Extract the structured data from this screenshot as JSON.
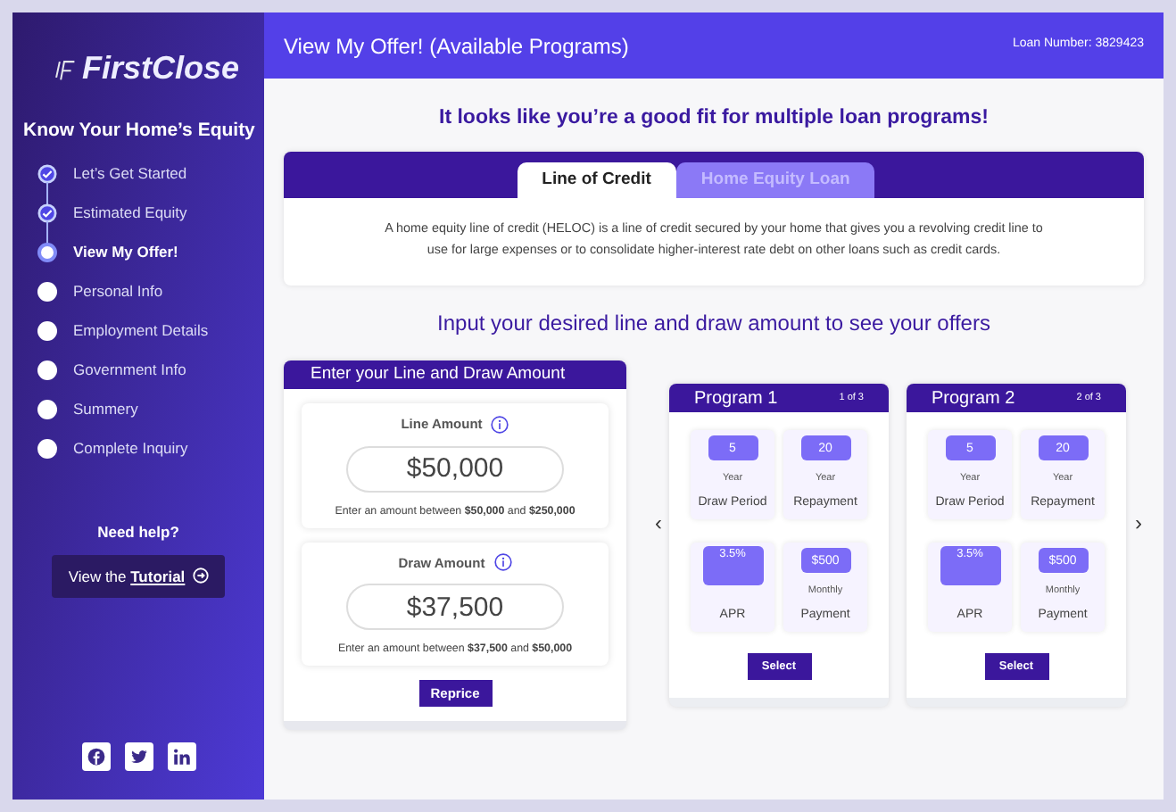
{
  "brand": {
    "name": "FirstClose"
  },
  "sidebar": {
    "title": "Know Your Home’s Equity",
    "steps": [
      {
        "label": "Let’s Get Started",
        "completed": true,
        "selected": false
      },
      {
        "label": "Estimated Equity",
        "completed": true,
        "selected": false
      },
      {
        "label": "View My Offer!",
        "completed": false,
        "selected": true
      },
      {
        "label": "Personal Info",
        "completed": false,
        "selected": false
      },
      {
        "label": "Employment Details",
        "completed": false,
        "selected": false
      },
      {
        "label": "Government Info",
        "completed": false,
        "selected": false
      },
      {
        "label": "Summery",
        "completed": false,
        "selected": false
      },
      {
        "label": "Complete Inquiry",
        "completed": false,
        "selected": false
      }
    ],
    "help": {
      "title": "Need help?",
      "button": "View the **Tutorial**"
    },
    "social": [
      {
        "kind": "facebook"
      },
      {
        "kind": "twitter"
      },
      {
        "kind": "linkedin"
      }
    ]
  },
  "header": {
    "title": "View My Offer! (Available Programs)",
    "loan_number": "Loan Number: 3829423"
  },
  "headline": "It looks like you’re a good fit for multiple loan programs!",
  "tabs": [
    {
      "label": "Line of Credit",
      "selected": true
    },
    {
      "label": "Home Equity Loan",
      "selected": false
    }
  ],
  "description": "A home equity line of credit (HELOC) is a line of credit secured by your home that gives you a revolving credit line to use for large expenses or to consolidate higher-interest rate debt on other loans such as credit cards.",
  "subheadline": "Input your desired line and draw amount to see your offers",
  "amount_card": {
    "title": "Enter your Line and Draw Amount",
    "fields": [
      {
        "label": "Line Amount",
        "value": "$50,000",
        "hint": "Enter an amount between **$50,000** and **$250,000**"
      },
      {
        "label": "Draw Amount",
        "value": "$37,500",
        "hint": "Enter an amount between **$37,500** and **$50,000**"
      }
    ],
    "button": "Reprice"
  },
  "carousel": {
    "prev": "‹",
    "next": "›"
  },
  "programs": [
    {
      "title": "Program 1",
      "counter": "1 of 3",
      "stats": [
        {
          "value": "5",
          "unit": "Year",
          "label": "Draw Period"
        },
        {
          "value": "20",
          "unit": "Year",
          "label": "Repayment"
        },
        {
          "value": "3.5%",
          "label": "APR"
        },
        {
          "value": "$500",
          "unit": "Monthly",
          "label": "Payment"
        }
      ],
      "button": "Select"
    },
    {
      "title": "Program 2",
      "counter": "2 of 3",
      "stats": [
        {
          "value": "5",
          "unit": "Year",
          "label": "Draw Period"
        },
        {
          "value": "20",
          "unit": "Year",
          "label": "Repayment"
        },
        {
          "value": "3.5%",
          "label": "APR"
        },
        {
          "value": "$500",
          "unit": "Monthly",
          "label": "Payment"
        }
      ],
      "button": "Select"
    }
  ]
}
